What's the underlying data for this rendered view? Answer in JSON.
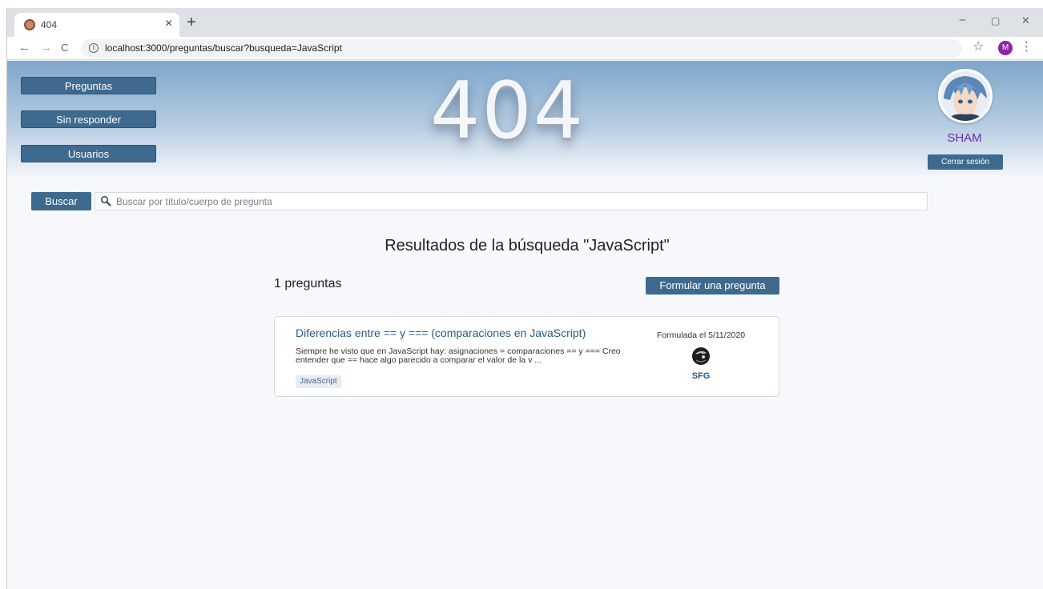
{
  "browser": {
    "tab_title": "404",
    "tab_close": "×",
    "new_tab": "+",
    "minimize": "−",
    "maximize": "▢",
    "close": "✕",
    "back": "←",
    "forward": "→",
    "reload": "C",
    "url": "localhost:3000/preguntas/buscar?busqueda=JavaScript",
    "star": "☆",
    "profile_initial": "M",
    "menu": "⋮"
  },
  "nav": {
    "items": [
      {
        "label": "Preguntas"
      },
      {
        "label": "Sin responder"
      },
      {
        "label": "Usuarios"
      }
    ]
  },
  "header": {
    "logo": "404"
  },
  "user": {
    "name": "SHAM",
    "logout_label": "Cerrar sesión"
  },
  "search": {
    "button_label": "Buscar",
    "placeholder": "Buscar por título/cuerpo de pregunta",
    "value": ""
  },
  "results": {
    "title": "Resultados de la búsqueda \"JavaScript\"",
    "count_label": "1 preguntas",
    "ask_button_label": "Formular una pregunta",
    "items": [
      {
        "title": "Diferencias entre == y === (comparaciones en JavaScript)",
        "body": "Siempre he visto que en JavaScript hay: asignaciones = comparaciones == y === Creo entender que == hace algo parecido a comparar el valor de la v ...",
        "tag": "JavaScript",
        "date": "Formulada el 5/11/2020",
        "author": "SFG"
      }
    ]
  },
  "colors": {
    "primary": "#3d6a8e",
    "username": "#6a2fb1",
    "link": "#2c5a80"
  }
}
